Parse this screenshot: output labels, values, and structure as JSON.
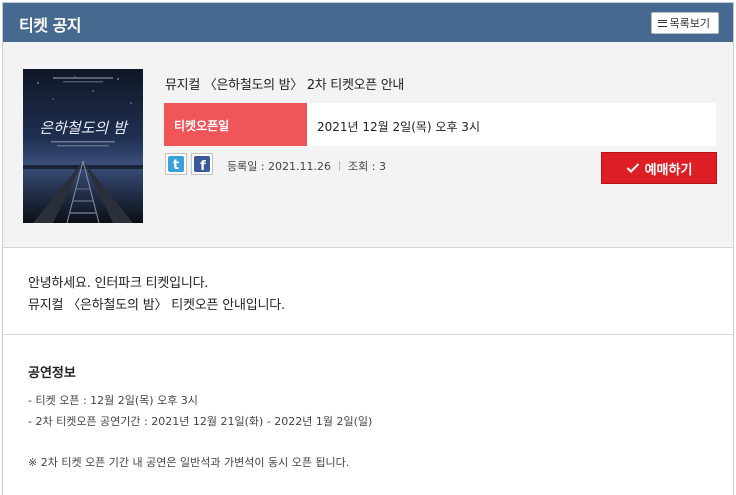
{
  "header": {
    "title": "티켓 공지",
    "list_button": "목록보기"
  },
  "show": {
    "title": "뮤지컬 〈은하철도의 밤〉 2차 티켓오픈 안내",
    "open_label": "티켓오픈일",
    "open_value": "2021년 12월 2일(목) 오후 3시",
    "registered": "등록일 : 2021.11.26",
    "views": "조회 : 3",
    "reserve_button": "예매하기",
    "poster_title": "은하철도의 밤"
  },
  "body": {
    "greeting": [
      "안녕하세요. 인터파크 티켓입니다.",
      "뮤지컬 〈은하철도의 밤〉 티켓오픈 안내입니다."
    ],
    "section_title": "공연정보",
    "details": [
      "- 티켓 오픈 : 12월 2일(목) 오후 3시",
      "- 2차 티켓오픈 공연기간 : 2021년 12월 21일(화) - 2022년 1월 2일(일)"
    ],
    "notice": "※ 2차 티켓 오픈 기간 내 공연은 일반석과 가변석이 동시 오픈 됩니다."
  },
  "colors": {
    "header_bg": "#466a8f",
    "open_label_bg": "#f0555a",
    "reserve_bg": "#de1e25"
  },
  "icons": [
    "menu-icon",
    "twitter-icon",
    "facebook-icon",
    "check-icon"
  ]
}
